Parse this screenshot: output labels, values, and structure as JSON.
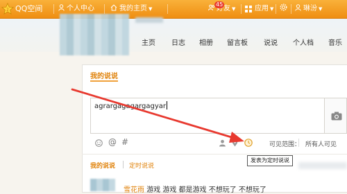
{
  "topbar": {
    "brand": "QQ空间",
    "items": [
      {
        "label": "个人中心",
        "icon": "person-icon"
      },
      {
        "label": "我的主页",
        "icon": "home-icon"
      },
      {
        "label": "好友",
        "icon": "friends-icon",
        "badge": "45"
      },
      {
        "label": "应用",
        "icon": "app-grid-icon"
      },
      {
        "label": "琳汾",
        "icon": "user-icon"
      }
    ]
  },
  "nav": {
    "items": [
      "主页",
      "日志",
      "相册",
      "留言板",
      "说说",
      "个人档",
      "音乐"
    ]
  },
  "composer": {
    "title": "我的说说",
    "text": "agrargagagargagyar",
    "visibility_label": "可见范围：",
    "visibility_value": "所有人可见",
    "tooltip": "发表为定时说说"
  },
  "tabs": {
    "mine": "我的说说",
    "scheduled": "定时说说"
  },
  "feed": {
    "name": "雪花雨",
    "text": "游戏  游戏  都是游戏  不想玩了  不想玩了"
  },
  "colors": {
    "topbar": "#f39a1d",
    "accent": "#e0830c",
    "arrow": "#e8392f"
  }
}
